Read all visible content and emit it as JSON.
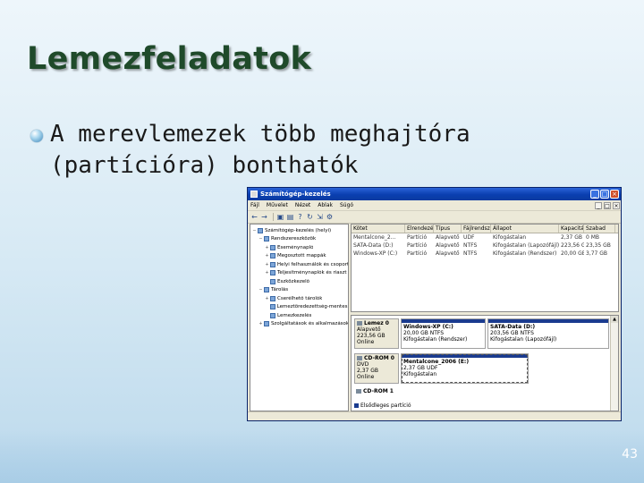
{
  "slide": {
    "title": "Lemezfeladatok",
    "bullet_line1": "A merevlemezek több meghajtóra",
    "bullet_line2": "(partícióra) bonthatók",
    "page_number": "43"
  },
  "window": {
    "title": "Számítógép-kezelés",
    "menu": [
      "Fájl",
      "Művelet",
      "Nézet",
      "Ablak",
      "Súgó"
    ],
    "toolbar_icons": [
      "back-arrow",
      "forward-arrow",
      "up-folder",
      "properties",
      "help",
      "refresh",
      "export",
      "settings"
    ],
    "tree": [
      {
        "label": "Számítógép-kezelés (helyi)",
        "level": 0,
        "expander": "−"
      },
      {
        "label": "Rendszereszközök",
        "level": 1,
        "expander": "−"
      },
      {
        "label": "Eseménynapló",
        "level": 2,
        "expander": "+"
      },
      {
        "label": "Megosztott mappák",
        "level": 2,
        "expander": "+"
      },
      {
        "label": "Helyi felhasználók és csoport",
        "level": 2,
        "expander": "+"
      },
      {
        "label": "Teljesítménynaplók és riaszt",
        "level": 2,
        "expander": "+"
      },
      {
        "label": "Eszközkezelő",
        "level": 2,
        "expander": ""
      },
      {
        "label": "Tárolás",
        "level": 1,
        "expander": "−"
      },
      {
        "label": "Cserélhető tárolók",
        "level": 2,
        "expander": "+"
      },
      {
        "label": "Lemeztöredezettség-mentesítő",
        "level": 2,
        "expander": ""
      },
      {
        "label": "Lemezkezelés",
        "level": 2,
        "expander": ""
      },
      {
        "label": "Szolgáltatások és alkalmazások",
        "level": 1,
        "expander": "+"
      }
    ],
    "volume_columns": [
      "Kötet",
      "Elrendezés",
      "Típus",
      "Fájlrendszer",
      "Állapot",
      "Kapacitás",
      "Szabad"
    ],
    "volumes": [
      [
        "Mentalcone_2...",
        "Partíció",
        "Alapvető",
        "UDF",
        "Kifogástalan",
        "2,37 GB",
        "0 MB"
      ],
      [
        "SATA-Data (D:)",
        "Partíció",
        "Alapvető",
        "NTFS",
        "Kifogástalan (Lapozófájl)",
        "223,56 GB",
        "23,35 GB"
      ],
      [
        "Windows-XP (C:)",
        "Partíció",
        "Alapvető",
        "NTFS",
        "Kifogástalan (Rendszer)",
        "20,00 GB",
        "3,77 GB"
      ]
    ],
    "disks": [
      {
        "name": "Lemez 0",
        "type": "Alapvető",
        "size": "223,56 GB",
        "status": "Online",
        "partitions": [
          {
            "title": "Windows-XP (C:)",
            "size": "20,00 GB NTFS",
            "status": "Kifogástalan (Rendszer)"
          },
          {
            "title": "SATA-Data (D:)",
            "size": "203,56 GB NTFS",
            "status": "Kifogástalan (Lapozófájl)"
          }
        ]
      },
      {
        "name": "CD-ROM 0",
        "type": "DVD",
        "size": "2,37 GB",
        "status": "Online",
        "partitions": [
          {
            "title": "Mentalcone_2006 (E:)",
            "size": "2,37 GB UDF",
            "status": "Kifogástalan"
          }
        ]
      },
      {
        "name": "CD-ROM 1",
        "type": "",
        "size": "",
        "status": "",
        "partitions": []
      }
    ],
    "legend": "Elsődleges partíció"
  },
  "colors": {
    "title": "#1f4a2a",
    "window_titlebar": "#0a3fb0",
    "partition_bar": "#1a3b8f"
  }
}
